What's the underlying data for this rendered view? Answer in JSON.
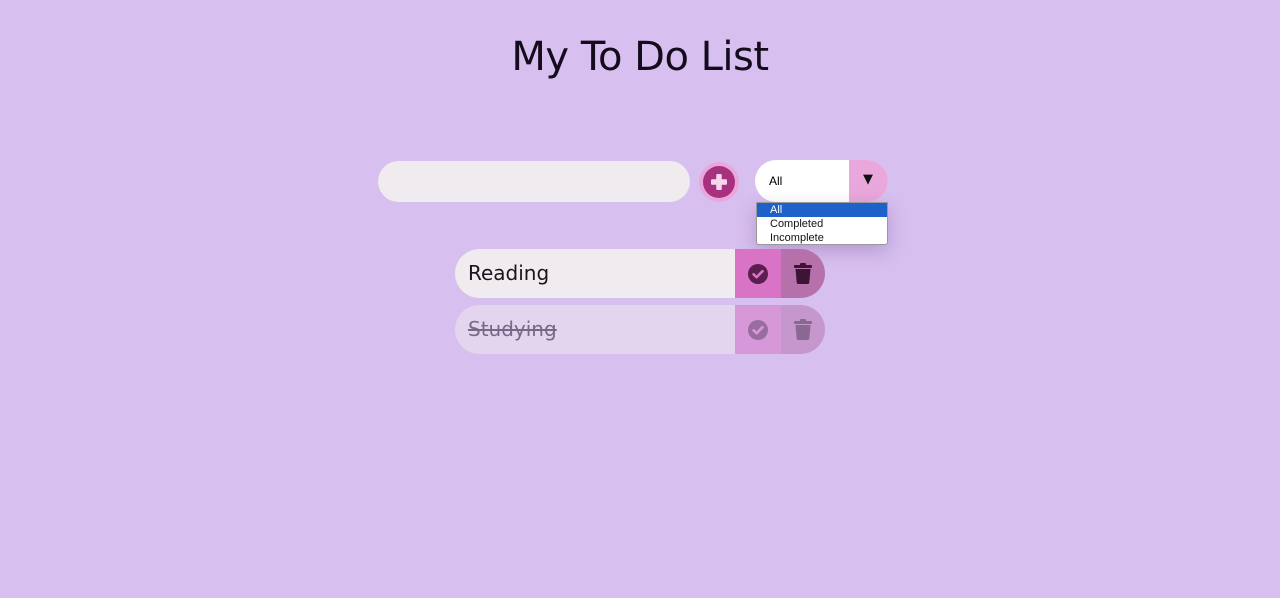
{
  "page": {
    "title": "My To Do List"
  },
  "input": {
    "value": "",
    "placeholder": ""
  },
  "add_button": {
    "icon": "plus-circle-icon"
  },
  "filter": {
    "selected": "All",
    "arrow_glyph": "▼",
    "options": [
      {
        "label": "All",
        "selected": true
      },
      {
        "label": "Completed",
        "selected": false
      },
      {
        "label": "Incomplete",
        "selected": false
      }
    ]
  },
  "todos": [
    {
      "text": "Reading",
      "completed": false,
      "check_icon": "check-circle-icon",
      "delete_icon": "trash-icon"
    },
    {
      "text": "Studying",
      "completed": true,
      "check_icon": "check-circle-icon",
      "delete_icon": "trash-icon"
    }
  ],
  "colors": {
    "background": "#d7bff0",
    "accent": "#e9a7dc",
    "accent_dark": "#a8317f",
    "check_bg": "#d873c6",
    "trash_bg": "#b671aa",
    "dropdown_highlight": "#1e62c9"
  }
}
